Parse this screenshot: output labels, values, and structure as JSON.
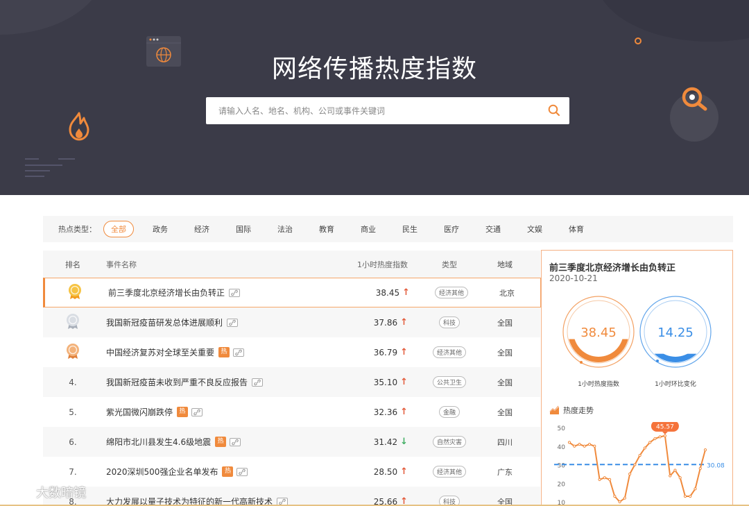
{
  "hero": {
    "title": "网络传播热度指数",
    "search_placeholder": "请输入人名、地名、机构、公司或事件关键词"
  },
  "filters": {
    "label": "热点类型：",
    "items": [
      "全部",
      "政务",
      "经济",
      "国际",
      "法治",
      "教育",
      "商业",
      "民生",
      "医疗",
      "交通",
      "文娱",
      "体育"
    ],
    "active": "全部"
  },
  "table": {
    "headers": {
      "rank": "排名",
      "name": "事件名称",
      "index": "1小时热度指数",
      "type": "类型",
      "region": "地域"
    },
    "rows": [
      {
        "rank": "1",
        "medal": "gold",
        "name": "前三季度北京经济增长由负转正",
        "hot": false,
        "index": "38.45",
        "trend": "up",
        "type": "经济其他",
        "region": "北京"
      },
      {
        "rank": "2",
        "medal": "silver",
        "name": "我国新冠疫苗研发总体进展顺利",
        "hot": false,
        "index": "37.86",
        "trend": "up",
        "type": "科技",
        "region": "全国"
      },
      {
        "rank": "3",
        "medal": "bronze",
        "name": "中国经济复苏对全球至关重要",
        "hot": true,
        "index": "36.79",
        "trend": "up",
        "type": "经济其他",
        "region": "全国"
      },
      {
        "rank": "4.",
        "medal": "",
        "name": "我国新冠疫苗未收到严重不良反应报告",
        "hot": false,
        "index": "35.10",
        "trend": "up",
        "type": "公共卫生",
        "region": "全国"
      },
      {
        "rank": "5.",
        "medal": "",
        "name": "紫光国微闪崩跌停",
        "hot": true,
        "index": "32.36",
        "trend": "up",
        "type": "金融",
        "region": "全国"
      },
      {
        "rank": "6.",
        "medal": "",
        "name": "绵阳市北川县发生4.6级地震",
        "hot": true,
        "index": "31.42",
        "trend": "down",
        "type": "自然灾害",
        "region": "四川"
      },
      {
        "rank": "7.",
        "medal": "",
        "name": "2020深圳500强企业名单发布",
        "hot": true,
        "index": "28.50",
        "trend": "up",
        "type": "经济其他",
        "region": "广东"
      },
      {
        "rank": "8.",
        "medal": "",
        "name": "大力发展以量子技术为特征的新一代高新技术",
        "hot": false,
        "index": "25.66",
        "trend": "up",
        "type": "科技",
        "region": "全国"
      }
    ],
    "hot_label": "热",
    "arrow_up": "↑",
    "arrow_down": "↓"
  },
  "detail": {
    "title": "前三季度北京经济增长由负转正",
    "date": "2020-10-21",
    "gauge1": {
      "value": "38.45",
      "label": "1小时热度指数",
      "fill": 0.38,
      "color": "#f08a3c"
    },
    "gauge2": {
      "value": "14.25",
      "label": "1小时环比变化",
      "fill": 0.14,
      "color": "#3a8ee6"
    },
    "trend_title": "热度走势"
  },
  "chart_data": {
    "type": "line",
    "title": "热度走势",
    "y_ticks": [
      10,
      20,
      30,
      40,
      50
    ],
    "ylim": [
      10,
      50
    ],
    "values": [
      42,
      40,
      41,
      40,
      41,
      40,
      22,
      23,
      22,
      13,
      10,
      12,
      25,
      30,
      35,
      39,
      42,
      44,
      45,
      45.57,
      24,
      27,
      23,
      13,
      13,
      17,
      28,
      38
    ],
    "peak_label": "45.57",
    "average_line": 30.08,
    "average_label": "30.08",
    "colors": {
      "line": "#f08a3c",
      "average": "#3a8ee6",
      "peak_badge": "#f5733b"
    }
  },
  "watermark": {
    "text": "大数暗镜"
  },
  "colors": {
    "accent": "#f08a3c",
    "hero_bg": "#3b3b48",
    "blue": "#3a8ee6"
  }
}
